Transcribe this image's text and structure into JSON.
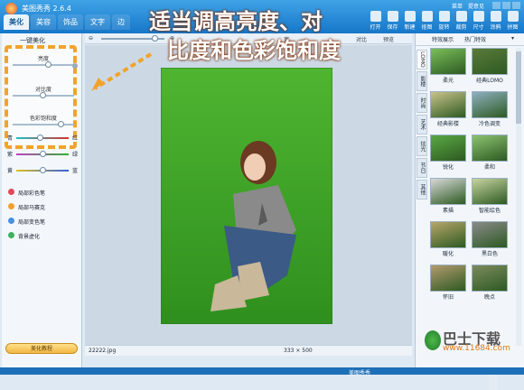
{
  "app": {
    "title": "美图秀秀 2.6.4"
  },
  "top_links": [
    "菜单",
    "提意见"
  ],
  "tabs": [
    {
      "label": "美化",
      "active": true
    },
    {
      "label": "美容"
    },
    {
      "label": "饰品"
    },
    {
      "label": "文字"
    },
    {
      "label": "边"
    }
  ],
  "toolbar": [
    "打开",
    "保存",
    "新建",
    "抠图",
    "旋转",
    "裁剪",
    "尺寸",
    "涂鸦",
    "拼图"
  ],
  "left_panel": {
    "header": "一键美化",
    "sliders": [
      {
        "label": "亮度",
        "value": 0.58
      },
      {
        "label": "对比度",
        "value": 0.48
      },
      {
        "label": "色彩饱和度",
        "value": 0.78
      }
    ],
    "color_balance": [
      {
        "left": "青",
        "right": "红",
        "value": 0.45
      },
      {
        "left": "紫",
        "right": "绿",
        "value": 0.5
      },
      {
        "left": "黄",
        "right": "蓝",
        "value": 0.5
      }
    ],
    "brushes": [
      "局部彩色笔",
      "局部马赛克",
      "局部变色笔",
      "背景虚化"
    ],
    "help_button": "美化教程"
  },
  "zoom_bar": {
    "percent": "",
    "tools": [
      "宽",
      "对比",
      "预览"
    ]
  },
  "status": {
    "filename": "22222.jpg",
    "dimensions": "333 × 500"
  },
  "right_panel": {
    "tabs": [
      "特效展示",
      "热门特效"
    ],
    "vertical_tabs": [
      "LOMO",
      "影楼",
      "时尚",
      "艺术",
      "炫光",
      "节日",
      "其他"
    ],
    "effects": [
      {
        "label": "柔光",
        "tint": "#7bbf5a"
      },
      {
        "label": "经典LOMO",
        "tint": "#5b7a3a"
      },
      {
        "label": "经典影楼",
        "tint": "#c9c38a"
      },
      {
        "label": "冷色调变",
        "tint": "#8fb0c0"
      },
      {
        "label": "锐化",
        "tint": "#5aa843"
      },
      {
        "label": "柔和",
        "tint": "#8cc370"
      },
      {
        "label": "素描",
        "tint": "#d8d8d8"
      },
      {
        "label": "智能绘色",
        "tint": "#c6d4a0"
      },
      {
        "label": "暖化",
        "tint": "#b8a66a"
      },
      {
        "label": "黑白色",
        "tint": "#8a8a8a"
      },
      {
        "label": "怀旧",
        "tint": "#b39a6e"
      },
      {
        "label": "晚点",
        "tint": "#7c8a5e"
      }
    ]
  },
  "annotation": {
    "line1": "适当调高亮度、对",
    "line2": "比度和色彩饱和度"
  },
  "watermark": {
    "name": "巴士下载",
    "url": "www.11684.com"
  },
  "taskbar": {
    "label": "美图秀秀"
  },
  "colors": {
    "title_bar": "#1677c9",
    "dash_highlight": "#f2a32a",
    "grass": "#3fa52a"
  }
}
